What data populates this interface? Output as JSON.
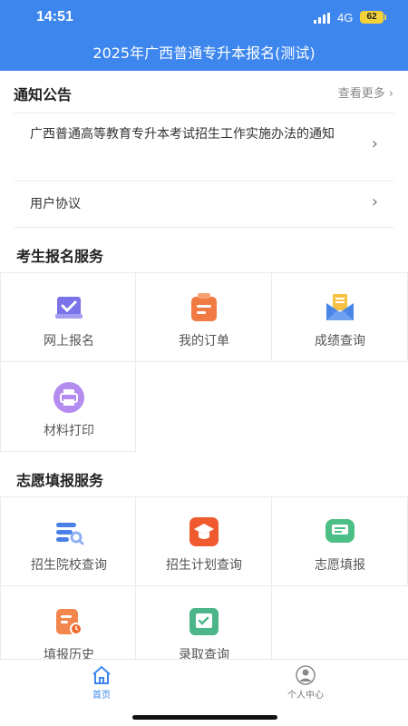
{
  "status": {
    "time": "14:51",
    "network": "4G",
    "battery": "62"
  },
  "navbar": {
    "title": "2025年广西普通专升本报名(测试)"
  },
  "notice": {
    "title": "通知公告",
    "more_label": "查看更多",
    "items": [
      {
        "text": "广西普通高等教育专升本考试招生工作实施办法的通知"
      },
      {
        "text": "用户协议"
      }
    ]
  },
  "exam_services": {
    "title": "考生报名服务",
    "items": [
      {
        "label": "网上报名",
        "icon": "online-signup-icon"
      },
      {
        "label": "我的订单",
        "icon": "order-icon"
      },
      {
        "label": "成绩查询",
        "icon": "score-mail-icon"
      },
      {
        "label": "材料打印",
        "icon": "printer-icon"
      }
    ]
  },
  "volunteer_services": {
    "title": "志愿填报服务",
    "items": [
      {
        "label": "招生院校查询",
        "icon": "school-search-icon"
      },
      {
        "label": "招生计划查询",
        "icon": "graduation-cap-icon"
      },
      {
        "label": "志愿填报",
        "icon": "message-icon"
      },
      {
        "label": "填报历史",
        "icon": "history-clock-icon"
      },
      {
        "label": "录取查询",
        "icon": "admission-check-icon"
      }
    ]
  },
  "tabbar": {
    "items": [
      {
        "label": "首页",
        "icon": "home-icon",
        "active": true
      },
      {
        "label": "个人中心",
        "icon": "user-center-icon",
        "active": false
      }
    ]
  },
  "colors": {
    "primary": "#3d86ee",
    "battery": "#f2d13a"
  }
}
